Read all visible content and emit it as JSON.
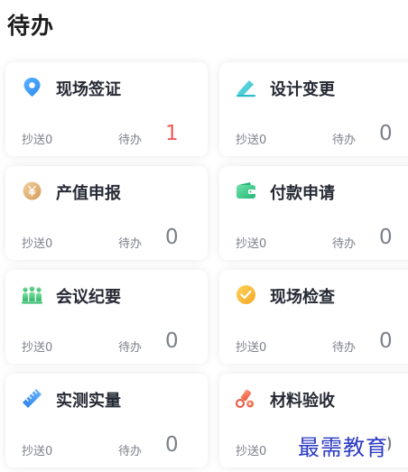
{
  "page": {
    "title": "待办"
  },
  "cards": [
    {
      "title": "现场签证",
      "icon": "location-pin-icon",
      "cc_label": "抄送0",
      "todo_label": "待办",
      "todo_count": "1",
      "todo_color": "#ee5a5a"
    },
    {
      "title": "设计变更",
      "icon": "pencil-icon",
      "cc_label": "抄送0",
      "todo_label": "待办",
      "todo_count": "0"
    },
    {
      "title": "产值申报",
      "icon": "yen-coin-icon",
      "cc_label": "抄送0",
      "todo_label": "待办",
      "todo_count": "0"
    },
    {
      "title": "付款申请",
      "icon": "wallet-icon",
      "cc_label": "抄送0",
      "todo_label": "待办",
      "todo_count": "0"
    },
    {
      "title": "会议纪要",
      "icon": "meeting-people-icon",
      "cc_label": "抄送0",
      "todo_label": "待办",
      "todo_count": "0"
    },
    {
      "title": "现场检查",
      "icon": "check-circle-icon",
      "cc_label": "抄送0",
      "todo_label": "待办",
      "todo_count": "0"
    },
    {
      "title": "实测实量",
      "icon": "ruler-icon",
      "cc_label": "抄送0",
      "todo_label": "待办",
      "todo_count": "0"
    },
    {
      "title": "材料验收",
      "icon": "materials-icon",
      "cc_label": "抄送0",
      "todo_label": "待办",
      "todo_count": "0"
    }
  ],
  "watermark": {
    "text": "最需教育"
  },
  "colors": {
    "alert": "#ee5a5a",
    "muted": "#7c808a",
    "title": "#252a34",
    "watermark": "#2b3bc4"
  }
}
